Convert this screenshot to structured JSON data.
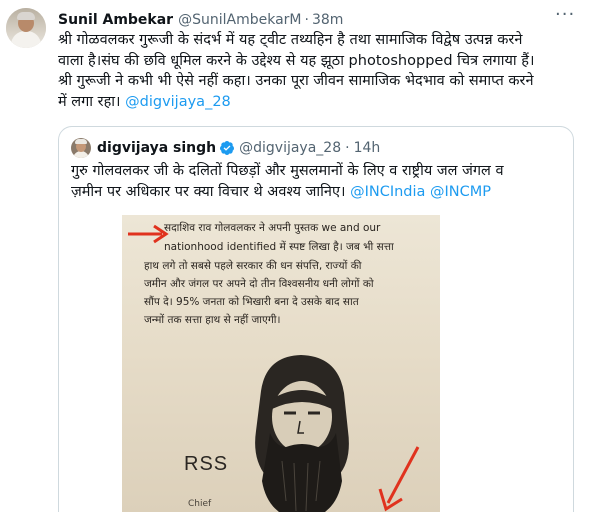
{
  "tweet": {
    "author_name": "Sunil Ambekar",
    "author_handle": "@SunilAmbekarM",
    "separator": "·",
    "time": "38m",
    "text_lines": [
      "श्री गोळवलकर गुरूजी के संदर्भ में यह ट्वीट तथ्यहिन है तथा सामाजिक विद्वेष उत्पन्न करने",
      "वाला है।संघ की छवि धूमिल करने के उद्देश्य से यह झूठा photoshopped चित्र लगाया हैं।",
      "श्री गुरूजी ने कभी भी ऐसे नहीं कहा। उनका पूरा जीवन सामाजिक भेदभाव को समाप्त करने"
    ],
    "last_line_text": "में लगा रहा। ",
    "mention": "@digvijaya_28"
  },
  "quote": {
    "author_name": "digvijaya singh",
    "author_handle": "@digvijaya_28",
    "separator": "·",
    "time": "14h",
    "text_line1": "गुरु गोलवलकर जी के दलितों पिछड़ों और मुसलमानों के लिए व राष्ट्रीय जल जंगल व",
    "text_line2": "ज़मीन पर अधिकार पर क्या विचार थे अवश्य जानिए। ",
    "mention1": "@INCIndia",
    "mention2": "@INCMP"
  },
  "media": {
    "lines": [
      "सदाशिव राव गोलवलकर ने अपनी पुस्तक we and our",
      "nationhood identified में स्पष्ट लिखा है। जब भी सत्ता",
      "हाथ लगे तो सबसे पहले सरकार की धन संपत्ति, राज्यों की",
      "जमीन और जंगल पर अपने दो तीन विश्वसनीय धनी लोगों को",
      "सौंप दे। 95% जनता को भिखारी बना दे उसके बाद सात",
      "जन्मों तक सत्ता हाथ से नहीं जाएगी।"
    ],
    "logo_text": "RSS",
    "caption": "Chief"
  },
  "colors": {
    "text": "#0f1419",
    "secondary": "#536471",
    "link": "#1d9bf0",
    "border": "#cfd9de",
    "verified": "#1d9bf0",
    "arrow": "#e0321e"
  },
  "icons": [
    "more-icon",
    "verified-badge-icon",
    "red-arrow-icon"
  ]
}
